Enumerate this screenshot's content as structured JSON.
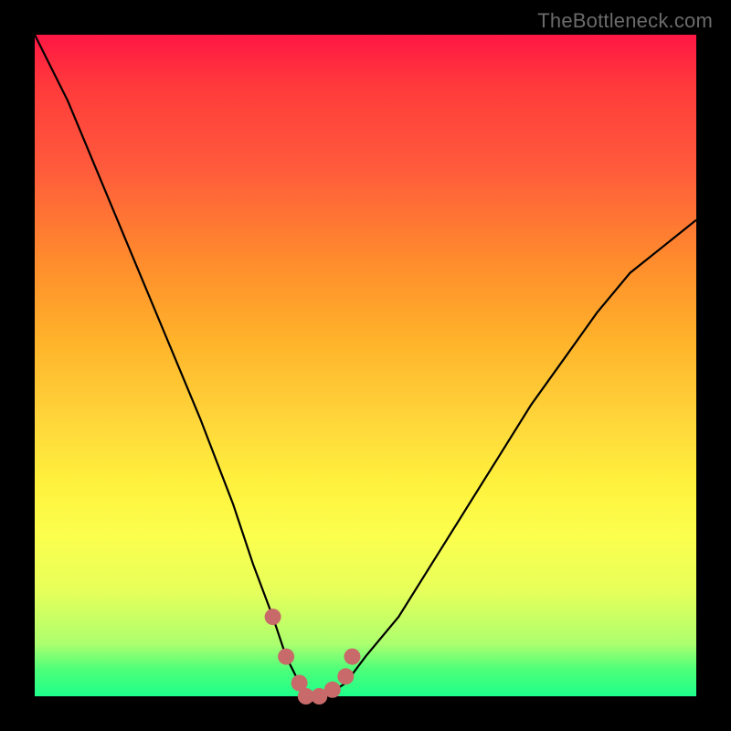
{
  "watermark": "TheBottleneck.com",
  "colors": {
    "frame": "#000000",
    "gradient_top": "#ff1744",
    "gradient_bottom": "#1fff8a",
    "curve": "#000000",
    "marker": "#c96a6a"
  },
  "chart_data": {
    "type": "line",
    "title": "",
    "xlabel": "",
    "ylabel": "",
    "xlim": [
      0,
      100
    ],
    "ylim": [
      0,
      100
    ],
    "series": [
      {
        "name": "bottleneck-curve",
        "x": [
          0,
          5,
          10,
          15,
          20,
          25,
          30,
          33,
          36,
          38,
          40,
          42,
          44,
          47,
          50,
          55,
          60,
          65,
          70,
          75,
          80,
          85,
          90,
          95,
          100
        ],
        "y": [
          100,
          90,
          78,
          66,
          54,
          42,
          29,
          20,
          12,
          6,
          2,
          0,
          0,
          2,
          6,
          12,
          20,
          28,
          36,
          44,
          51,
          58,
          64,
          68,
          72
        ]
      }
    ],
    "markers": {
      "name": "highlighted-points",
      "x": [
        36,
        38,
        40,
        41,
        43,
        45,
        47,
        48
      ],
      "y": [
        12,
        6,
        2,
        0,
        0,
        1,
        3,
        6
      ]
    }
  }
}
